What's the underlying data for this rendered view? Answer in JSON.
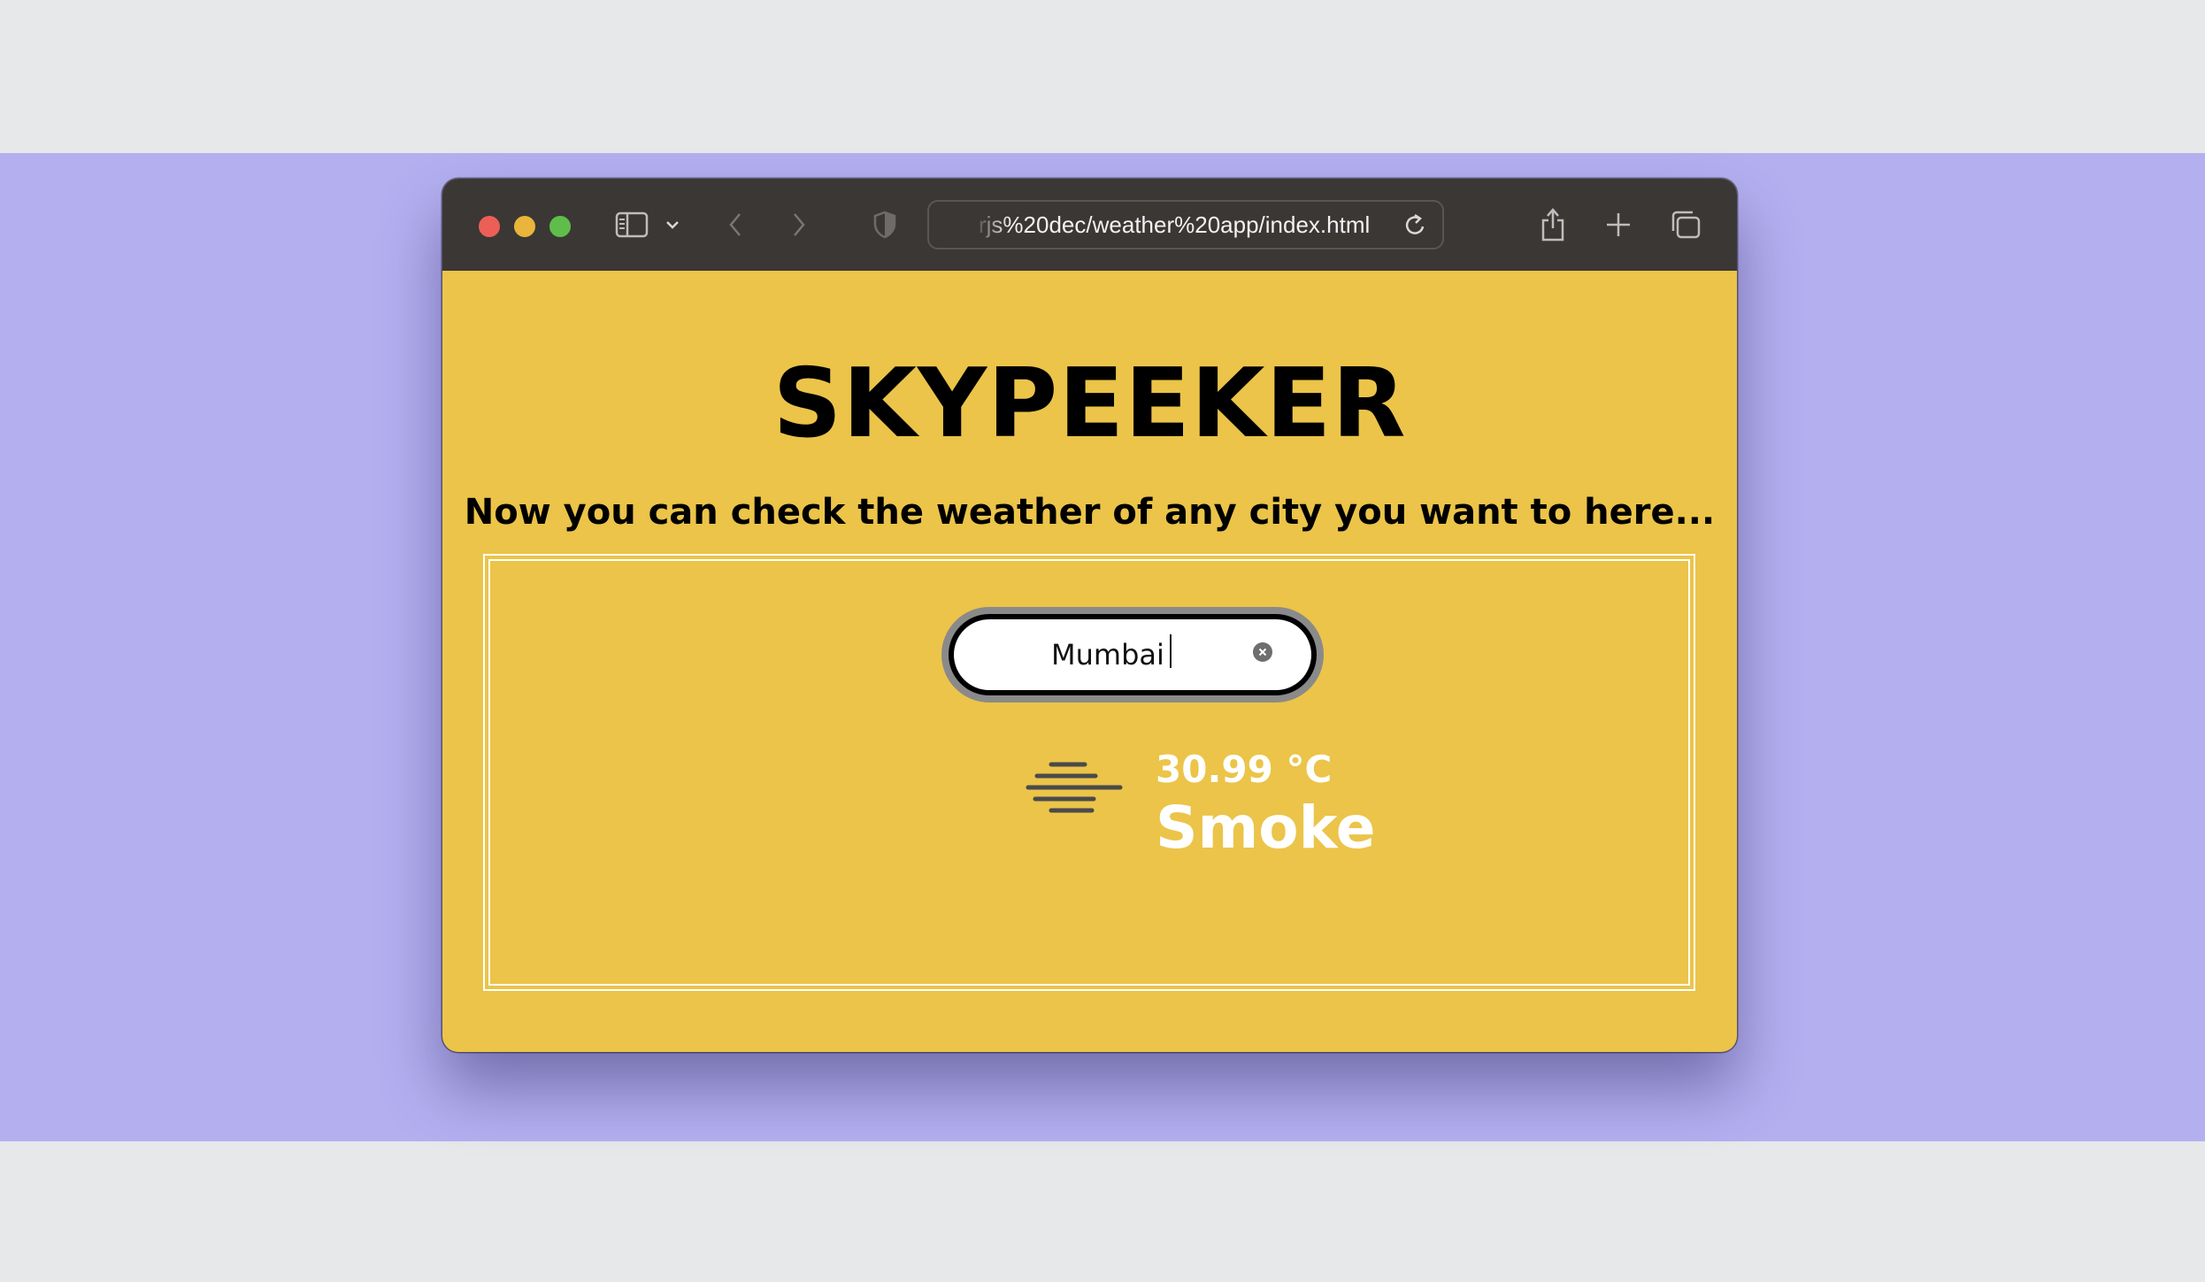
{
  "browser": {
    "url": "rjs%20dec/weather%20app/index.html",
    "icons": [
      "sidebar-icon",
      "chevron-down-icon",
      "back-icon",
      "forward-icon",
      "shield-icon",
      "reload-icon",
      "share-icon",
      "new-tab-icon",
      "tabs-overview-icon"
    ]
  },
  "app": {
    "title": "SKYPEEKER",
    "subtitle": "Now you can check the weather of any city you want to here...",
    "search": {
      "value": "Mumbai"
    },
    "weather": {
      "temperature": "30.99 °C",
      "condition": "Smoke",
      "icon": "smoke-haze-icon"
    }
  },
  "colors": {
    "background_band": "#b4b0f0",
    "app_background": "#ebc449",
    "titlebar": "#3b3735",
    "text_primary": "#000000",
    "weather_text": "#ffffff"
  }
}
